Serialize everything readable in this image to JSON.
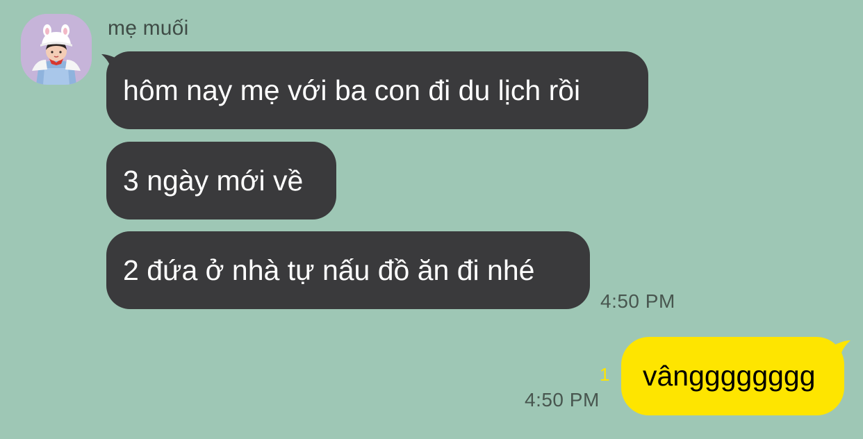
{
  "chat": {
    "background_color": "#9ec7b5",
    "sender": {
      "name": "mẹ muối",
      "avatar_icon": "child-avatar"
    },
    "incoming_messages": [
      {
        "text": "hôm nay mẹ với ba con đi du lịch rồi"
      },
      {
        "text": "3 ngày mới về"
      },
      {
        "text": "2 đứa ở nhà tự nấu đồ ăn đi nhé"
      }
    ],
    "incoming_time": "4:50 PM",
    "outgoing_message": {
      "text": "vângggggggg",
      "unread_count": "1",
      "time": "4:50 PM"
    },
    "colors": {
      "incoming_bubble": "#3a3a3c",
      "outgoing_bubble": "#fee500",
      "unread_count": "#fee500"
    }
  }
}
